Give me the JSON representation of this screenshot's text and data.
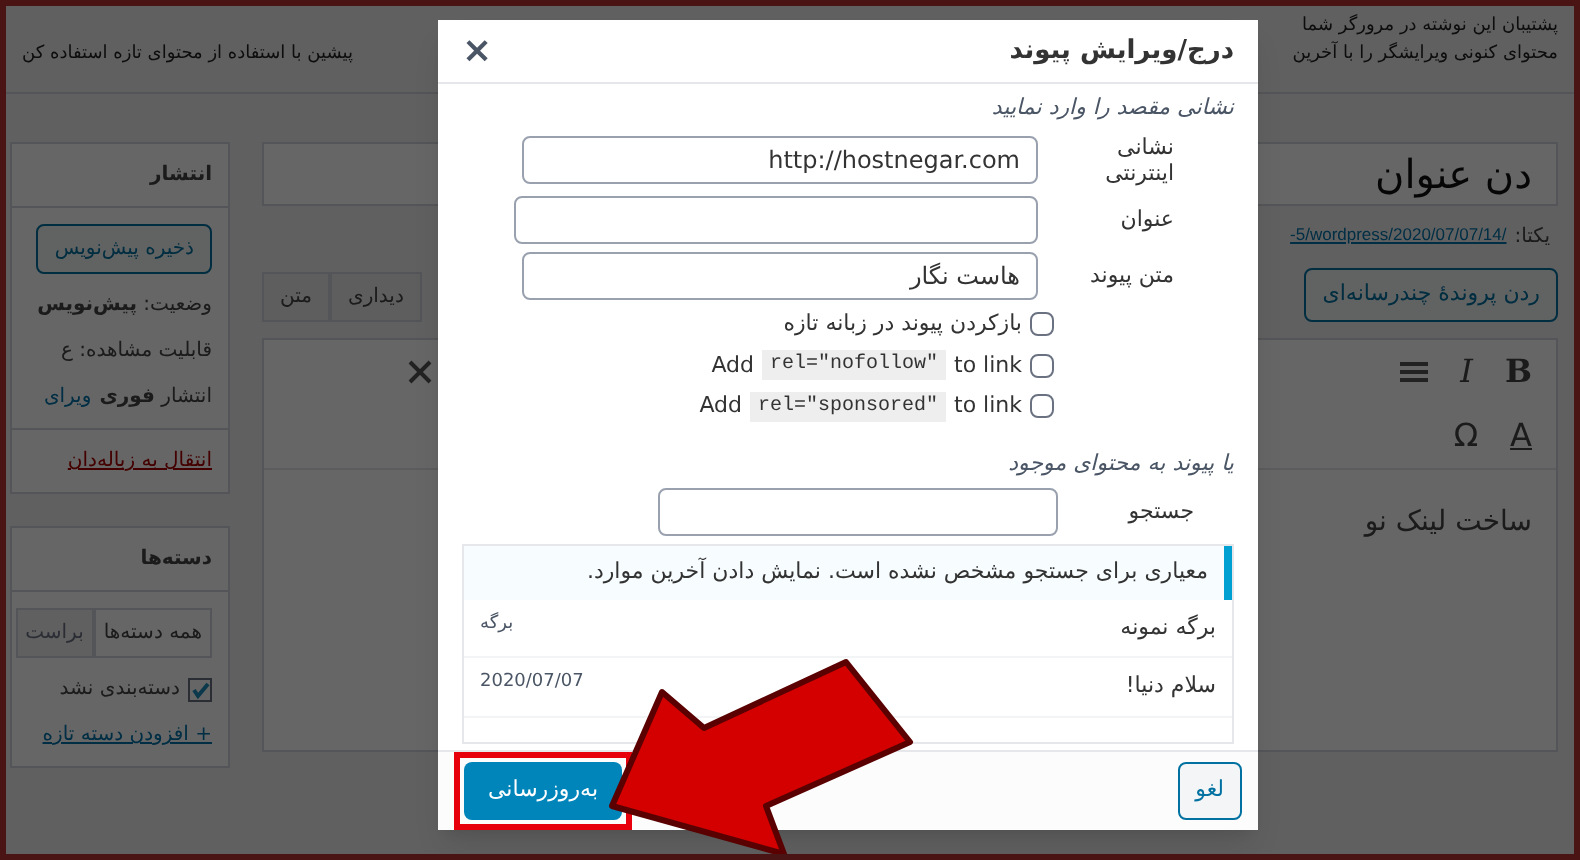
{
  "editor": {
    "notices": [
      "پشتیبان این نوشته در مرورگر شما",
      "محتوای کنونی ویرایشگر را با آخرین",
      "پیشین با استفاده از محتوای تازه استفاده کن"
    ],
    "title_placeholder": "دن عنوان",
    "permalink_label": "یکتا:",
    "permalink_url": "-5/wordpress/2020/07/07/14/",
    "add_media_button": "ردن پروندهٔ چندرسانه‌ای",
    "editor_tabs": [
      "دیداری",
      "متن"
    ],
    "toolbar_row_1": [
      "B",
      "I"
    ],
    "toolbar_row_2": [
      "A",
      "Ω"
    ],
    "content_text": "ساخت لینک نو"
  },
  "publish_box": {
    "title": "انتشار",
    "save_draft_button": "ذخیره پیش‌نویس",
    "status": "وضعیت: **پیش‌نویس**",
    "visibility": "قابلیت مشاهده: ع",
    "publish": "انتشار **فوری**",
    "edit_link": "ویرای",
    "trash_link": "انتقال به زباله‌دان"
  },
  "categories_box": {
    "title": "دسته‌ها",
    "tabs": [
      {
        "label": "همه دسته‌ها",
        "selected": true
      },
      {
        "label": "براست",
        "selected": false
      }
    ],
    "items": [
      {
        "label": "دسته‌بندی نشد",
        "checked": true
      }
    ],
    "add_link": "+ افزودن دسته تازه"
  },
  "dialog": {
    "title": "درج/ویرایش پیوند",
    "close": "×",
    "intro": "نشانی مقصد را وارد نمایید",
    "fields": [
      {
        "label": "نشانی اینترنتی",
        "value": "http://hostnegar.com"
      },
      {
        "label": "عنوان"
      },
      {
        "label": "متن پیوند",
        "value": "هاست نگار"
      }
    ],
    "options": [
      {
        "kind": "plain",
        "text": "بازکردن پیوند در زبانه تازه",
        "checked": false
      },
      {
        "kind": "rel",
        "before": "Add",
        "code": "rel=\"nofollow\"",
        "after": "to link",
        "checked": false
      },
      {
        "kind": "rel",
        "before": "Add",
        "code": "rel=\"sponsored\"",
        "after": "to link",
        "checked": false
      }
    ],
    "existing_heading": "یا پیوند به محتوای موجود",
    "search_label": "جستجو",
    "notice": "معیاری برای جستجو مشخص نشده است. نمایش دادن آخرین موارد.",
    "results": [
      {
        "title": "برگه نمونه",
        "info": "برگه"
      },
      {
        "title": "سلام دنیا!",
        "info": "2020/07/07"
      }
    ],
    "update_button": "به‌روزرسانی",
    "cancel_button": "لغو"
  }
}
